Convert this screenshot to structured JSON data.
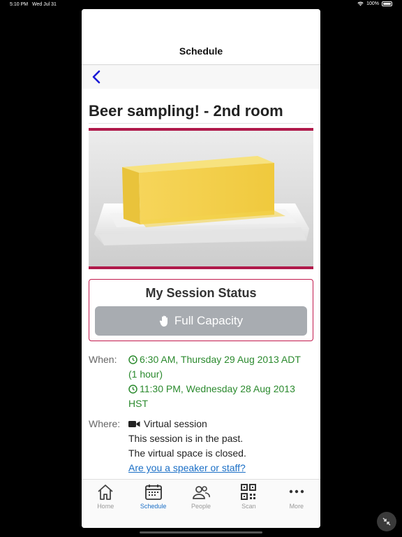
{
  "status_bar": {
    "time": "5:10 PM",
    "date": "Wed Jul 31",
    "battery": "100%"
  },
  "nav": {
    "title": "Schedule"
  },
  "event": {
    "title": "Beer sampling! - 2nd room",
    "image_icon": "butter-photo"
  },
  "session_status": {
    "header": "My Session Status",
    "button_label": "Full Capacity",
    "button_icon": "hand-icon"
  },
  "when": {
    "label": "When:",
    "time1_line1": "6:30 AM, Thursday 29 Aug 2013 ADT",
    "time1_line2": "(1 hour)",
    "time2_line1": "11:30 PM, Wednesday 28 Aug 2013",
    "time2_line2": "HST"
  },
  "where": {
    "label": "Where:",
    "venue": "Virtual session",
    "past_note": "This session is in the past.",
    "closed_note": "The virtual space is closed.",
    "staff_link": "Are you a speaker or staff?"
  },
  "tabs": [
    {
      "label": "Home",
      "icon": "home-icon"
    },
    {
      "label": "Schedule",
      "icon": "calendar-icon"
    },
    {
      "label": "People",
      "icon": "people-icon"
    },
    {
      "label": "Scan",
      "icon": "qr-icon"
    },
    {
      "label": "More",
      "icon": "more-icon"
    }
  ],
  "colors": {
    "accent": "#b01a4b",
    "link": "#1b6fc6",
    "time_green": "#2b8a2e",
    "button_gray": "#a8acb1"
  }
}
